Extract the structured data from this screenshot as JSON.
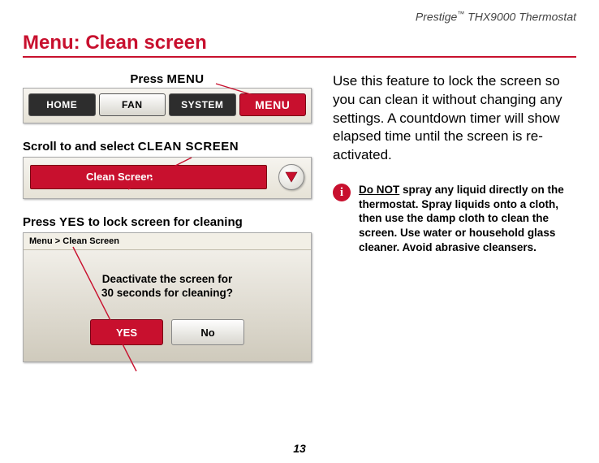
{
  "product": {
    "name": "Prestige",
    "tm": "™",
    "model": "THX9000 Thermostat"
  },
  "page_title": "Menu: Clean screen",
  "steps": {
    "s1_prefix": "Press ",
    "s1_kw": "MENU",
    "s2_prefix": "Scroll to and select ",
    "s2_kw": "CLEAN SCREEN",
    "s3_prefix": "Press ",
    "s3_kw": "YES",
    "s3_suffix": " to lock screen for cleaning"
  },
  "nav": {
    "home": "HOME",
    "fan": "FAN",
    "system": "SYSTEM",
    "menu": "MENU"
  },
  "cleanbar_label": "Clean Screen",
  "dialog": {
    "breadcrumb": "Menu > Clean Screen",
    "line1": "Deactivate the screen for",
    "line2": "30 seconds for cleaning?",
    "yes": "YES",
    "no": "No"
  },
  "desc": "Use this feature to lock the screen so you can clean it without chang­ing any settings. A countdown timer will show elapsed time until the screen is re-activated.",
  "info": {
    "donot": "Do NOT",
    "rest": " spray any liquid directly on the thermostat. Spray liquids onto a cloth, then use the damp cloth to clean the screen. Use water or household glass cleaner. Avoid abrasive cleansers."
  },
  "page_number": "13"
}
